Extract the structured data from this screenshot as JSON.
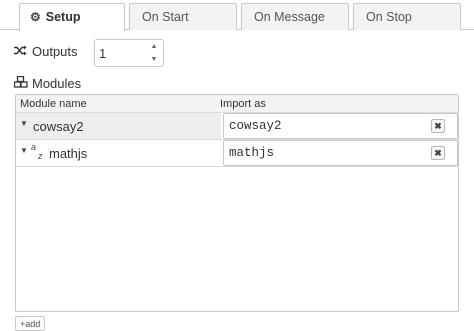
{
  "tabs": [
    {
      "label": "Setup",
      "icon": "gear-icon",
      "active": true
    },
    {
      "label": "On Start"
    },
    {
      "label": "On Message"
    },
    {
      "label": "On Stop"
    }
  ],
  "outputs": {
    "label": "Outputs",
    "icon": "shuffle-icon",
    "value": "1"
  },
  "modules": {
    "label": "Modules",
    "icon": "cubes-icon",
    "columns": [
      "Module name",
      "Import as"
    ],
    "rows": [
      {
        "name": "cowsay2",
        "import_as": "cowsay2",
        "delete": "✖"
      },
      {
        "name": "mathjs",
        "import_as": "mathjs",
        "az_top": "a",
        "az_bottom": "z",
        "delete": "✖"
      }
    ]
  },
  "add_button": {
    "label": "add"
  }
}
